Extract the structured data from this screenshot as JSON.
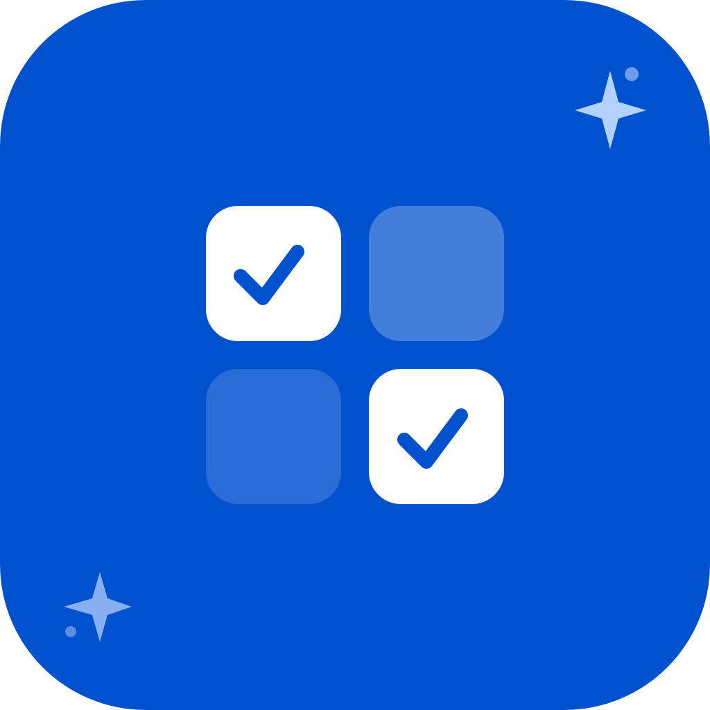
{
  "icon": {
    "name": "checklist-grid-app-icon",
    "colors": {
      "background": "#0051CD",
      "tile_checked": "#FFFFFF",
      "tile_unchecked_light": "#437FDA",
      "tile_unchecked_dim": "#2A6CD6",
      "checkmark": "#0051CD",
      "sparkle_top_right": "#B3D2FF",
      "sparkle_bottom_left": "#86B0F0",
      "dot_top_right": "#6D9CEB",
      "dot_bottom_left": "#5B8DE6"
    },
    "grid": {
      "tiles": [
        {
          "position": "top-left",
          "state": "checked",
          "icon": "checkmark-icon"
        },
        {
          "position": "top-right",
          "state": "unchecked"
        },
        {
          "position": "bottom-left",
          "state": "unchecked"
        },
        {
          "position": "bottom-right",
          "state": "checked",
          "icon": "checkmark-icon"
        }
      ]
    },
    "decorations": [
      {
        "type": "sparkle-icon",
        "corner": "top-right"
      },
      {
        "type": "dot",
        "corner": "top-right"
      },
      {
        "type": "sparkle-icon",
        "corner": "bottom-left"
      },
      {
        "type": "dot",
        "corner": "bottom-left"
      }
    ]
  }
}
